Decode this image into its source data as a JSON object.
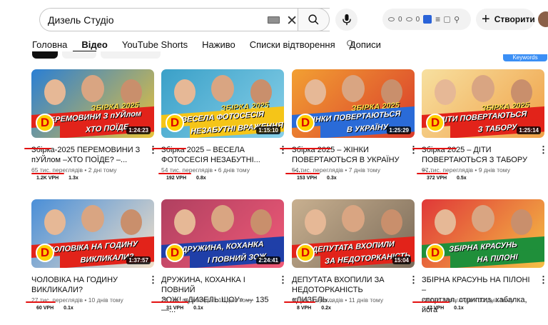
{
  "search": {
    "query": "Дизель Студіо"
  },
  "extension": {
    "count1": "0",
    "count2": "0"
  },
  "header": {
    "create_label": "Створити"
  },
  "tabs": [
    {
      "label": "Головна"
    },
    {
      "label": "Відео"
    },
    {
      "label": "YouTube Shorts"
    },
    {
      "label": "Наживо"
    },
    {
      "label": "Списки відтворення"
    },
    {
      "label": "Дописи"
    }
  ],
  "keywords_badge": "Keywords",
  "videos": [
    {
      "title_l1": "Збірка-2025 ПЕРЕМОВИНИ З",
      "title_l2": "пУЙлом –ХТО ПОЇДЕ? –...",
      "meta": "65 тис. переглядів • 2 дні тому",
      "vph": "1.2K VPH",
      "ratio": "1.3x",
      "duration": "1:24:23",
      "thumb_line1": "ЗБІРКА 2025",
      "thumb_line2": "ПЕРЕМОВИНИ З пУЙлом",
      "thumb_line3": "ХТО ПОЇДЕ",
      "logo": "D"
    },
    {
      "title_l1": "Збірка 2025 – ВЕСЕЛА",
      "title_l2": "ФОТОСЕСІЯ НЕЗАБУТНІ...",
      "meta": "54 тис. переглядів • 6 днів тому",
      "vph": "192 VPH",
      "ratio": "0.8x",
      "duration": "1:15:10",
      "thumb_line1": "ЗБІРКА 2025",
      "thumb_line2": "ВЕСЕЛА ФОТОСЕСІЯ",
      "thumb_line3": "НЕЗАБУТНІ ВРАЖЕННЯ",
      "logo": "D"
    },
    {
      "title_l1": "Збірка 2025 – ЖІНКИ",
      "title_l2": "ПОВЕРТАЮТЬСЯ В УКРАЇНУ –...",
      "meta": "54 тис. переглядів • 7 днів тому",
      "vph": "153 VPH",
      "ratio": "0.3x",
      "duration": "1:25:29",
      "thumb_line1": "ЗБІРКА 2025",
      "thumb_line2": "ЖІНКИ ПОВЕРТАЮТЬСЯ",
      "thumb_line3": "В УКРАЇНУ",
      "logo": "D"
    },
    {
      "title_l1": "Збірка 2025 – ДІТИ",
      "title_l2": "ПОВЕРТАЮТЬСЯ З ТАБОРУ –...",
      "meta": "97 тис. переглядів • 9 днів тому",
      "vph": "372 VPH",
      "ratio": "0.5x",
      "duration": "1:25:14",
      "thumb_line1": "ЗБІРКА 2025",
      "thumb_line2": "ДІТИ ПОВЕРТАЮТЬСЯ",
      "thumb_line3": "З ТАБОРУ",
      "logo": "D"
    },
    {
      "title_l1": "ЧОЛОВІКА НА ГОДИНУ",
      "title_l2": "ВИКЛИКАЛИ?",
      "meta": "27 тис. переглядів • 10 днів тому",
      "vph": "60 VPH",
      "ratio": "0.1x",
      "duration": "1:37:57",
      "thumb_line1": "",
      "thumb_line2": "ЧОЛОВІКА НА ГОДИНУ",
      "thumb_line3": "ВИКЛИКАЛИ?",
      "logo": "D"
    },
    {
      "title_l1": "ДРУЖИНА, КОХАНКА І ПОВНИЙ",
      "title_l2": "ЗОЖ! «ДИЗЕЛЬ ШОУ» — 135 —...",
      "meta": "18 тис. переглядів • 11 днів тому",
      "vph": "31 VPH",
      "ratio": "0.1x",
      "duration": "2:24:41",
      "thumb_line1": "",
      "thumb_line2": "ДРУЖИНА, КОХАНКА",
      "thumb_line3": "І ПОВНИЙ ЗОЖ",
      "logo": "D"
    },
    {
      "title_l1": "ДЕПУТАТА ВХОПИЛИ ЗА",
      "title_l2": "НЕДОТОРКАНІСТЬ «ДИЗЕЛЬ...",
      "meta": "35 тис. переглядів • 11 днів тому",
      "vph": "8 VPH",
      "ratio": "0.2x",
      "duration": "15:04",
      "thumb_line1": "",
      "thumb_line2": "ДЕПУТАТА ВХОПИЛИ",
      "thumb_line3": "ЗА НЕДОТОРКАНІСТЬ",
      "logo": "D"
    },
    {
      "title_l1": "ЗБІРНА КРАСУНЬ НА ПІЛОНІ –",
      "title_l2": "спортзал, стриптиз, хабалка, йога",
      "meta": "28 тис. переглядів • 12 днів тому",
      "vph": "47 VPH",
      "ratio": "0.1x",
      "duration": "",
      "thumb_line1": "",
      "thumb_line2": "ЗБІРНА КРАСУНЬ",
      "thumb_line3": "НА ПІЛОНІ",
      "logo": "D"
    }
  ],
  "colors": {
    "red_annotation": "#e31010",
    "stripe_yellow": "#f5c518",
    "stripe_red": "#e2231a",
    "stripe_blue": "#1f3fa8"
  }
}
